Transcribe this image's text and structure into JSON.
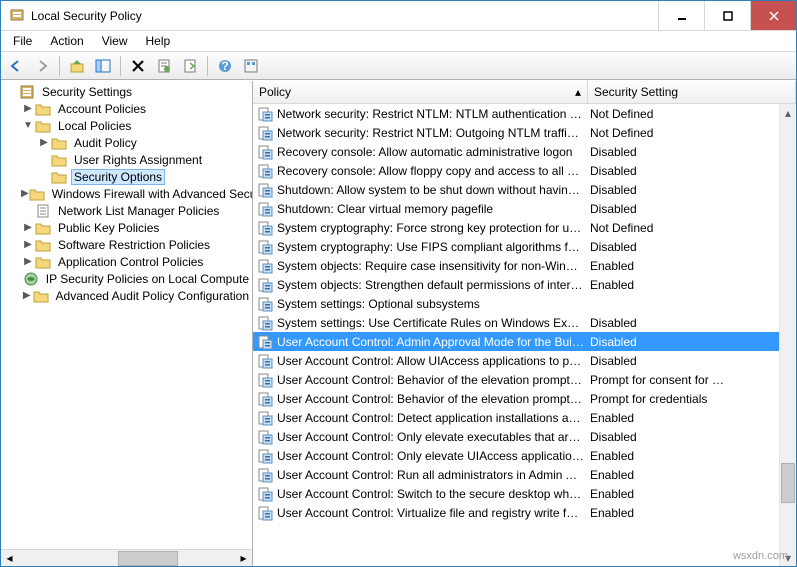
{
  "window": {
    "title": "Local Security Policy"
  },
  "menu": {
    "file": "File",
    "action": "Action",
    "view": "View",
    "help": "Help"
  },
  "tree": {
    "root": "Security Settings",
    "items": [
      {
        "label": "Account Policies",
        "indent": 1,
        "expander": "▶",
        "selected": false
      },
      {
        "label": "Local Policies",
        "indent": 1,
        "expander": "▼",
        "selected": false
      },
      {
        "label": "Audit Policy",
        "indent": 2,
        "expander": "▶",
        "selected": false
      },
      {
        "label": "User Rights Assignment",
        "indent": 2,
        "expander": "",
        "selected": false
      },
      {
        "label": "Security Options",
        "indent": 2,
        "expander": "",
        "selected": true
      },
      {
        "label": "Windows Firewall with Advanced Secu",
        "indent": 1,
        "expander": "▶",
        "selected": false
      },
      {
        "label": "Network List Manager Policies",
        "indent": 1,
        "expander": "",
        "selected": false
      },
      {
        "label": "Public Key Policies",
        "indent": 1,
        "expander": "▶",
        "selected": false
      },
      {
        "label": "Software Restriction Policies",
        "indent": 1,
        "expander": "▶",
        "selected": false
      },
      {
        "label": "Application Control Policies",
        "indent": 1,
        "expander": "▶",
        "selected": false
      },
      {
        "label": "IP Security Policies on Local Compute",
        "indent": 1,
        "expander": "",
        "selected": false
      },
      {
        "label": "Advanced Audit Policy Configuration",
        "indent": 1,
        "expander": "▶",
        "selected": false
      }
    ]
  },
  "list": {
    "col_policy": "Policy",
    "col_setting": "Security Setting",
    "rows": [
      {
        "policy": "Network security: Restrict NTLM: NTLM authentication in th…",
        "setting": "Not Defined",
        "selected": false
      },
      {
        "policy": "Network security: Restrict NTLM: Outgoing NTLM traffic to …",
        "setting": "Not Defined",
        "selected": false
      },
      {
        "policy": "Recovery console: Allow automatic administrative logon",
        "setting": "Disabled",
        "selected": false
      },
      {
        "policy": "Recovery console: Allow floppy copy and access to all drives…",
        "setting": "Disabled",
        "selected": false
      },
      {
        "policy": "Shutdown: Allow system to be shut down without having to…",
        "setting": "Disabled",
        "selected": false
      },
      {
        "policy": "Shutdown: Clear virtual memory pagefile",
        "setting": "Disabled",
        "selected": false
      },
      {
        "policy": "System cryptography: Force strong key protection for user k…",
        "setting": "Not Defined",
        "selected": false
      },
      {
        "policy": "System cryptography: Use FIPS compliant algorithms for en…",
        "setting": "Disabled",
        "selected": false
      },
      {
        "policy": "System objects: Require case insensitivity for non-Windows …",
        "setting": "Enabled",
        "selected": false
      },
      {
        "policy": "System objects: Strengthen default permissions of internal s…",
        "setting": "Enabled",
        "selected": false
      },
      {
        "policy": "System settings: Optional subsystems",
        "setting": "",
        "selected": false
      },
      {
        "policy": "System settings: Use Certificate Rules on Windows Executabl…",
        "setting": "Disabled",
        "selected": false
      },
      {
        "policy": "User Account Control: Admin Approval Mode for the Built-i…",
        "setting": "Disabled",
        "selected": true
      },
      {
        "policy": "User Account Control: Allow UIAccess applications to prom…",
        "setting": "Disabled",
        "selected": false
      },
      {
        "policy": "User Account Control: Behavior of the elevation prompt for …",
        "setting": "Prompt for consent for …",
        "selected": false
      },
      {
        "policy": "User Account Control: Behavior of the elevation prompt for …",
        "setting": "Prompt for credentials",
        "selected": false
      },
      {
        "policy": "User Account Control: Detect application installations and p…",
        "setting": "Enabled",
        "selected": false
      },
      {
        "policy": "User Account Control: Only elevate executables that are sign…",
        "setting": "Disabled",
        "selected": false
      },
      {
        "policy": "User Account Control: Only elevate UIAccess applications th…",
        "setting": "Enabled",
        "selected": false
      },
      {
        "policy": "User Account Control: Run all administrators in Admin Appr…",
        "setting": "Enabled",
        "selected": false
      },
      {
        "policy": "User Account Control: Switch to the secure desktop when pr…",
        "setting": "Enabled",
        "selected": false
      },
      {
        "policy": "User Account Control: Virtualize file and registry write failure…",
        "setting": "Enabled",
        "selected": false
      }
    ]
  },
  "watermark": "wsxdn.com"
}
